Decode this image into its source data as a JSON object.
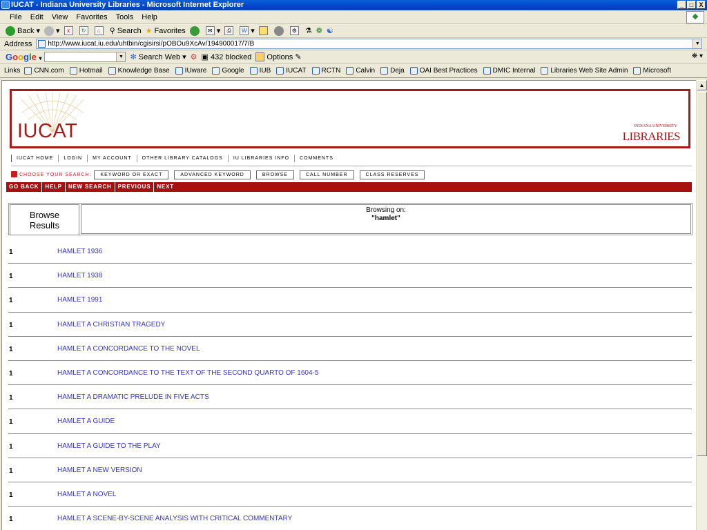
{
  "window": {
    "title": "IUCAT - Indiana University Libraries - Microsoft Internet Explorer",
    "minimize": "_",
    "maximize": "□",
    "close": "X"
  },
  "menu": [
    "File",
    "Edit",
    "View",
    "Favorites",
    "Tools",
    "Help"
  ],
  "toolbar": {
    "back": "Back",
    "search": "Search",
    "favorites": "Favorites"
  },
  "address": {
    "label": "Address",
    "url": "http://www.iucat.iu.edu/uhtbin/cgisirsi/pOBOu9XcAv/194900017/7/B"
  },
  "google": {
    "search_web": "Search Web",
    "blocked": "432 blocked",
    "options": "Options"
  },
  "links": {
    "label": "Links",
    "items": [
      "CNN.com",
      "Hotmail",
      "Knowledge Base",
      "IUware",
      "Google",
      "IUB",
      "IUCAT",
      "RCTN",
      "Calvin",
      "Deja",
      "OAI Best Practices",
      "DMIC Internal",
      "Libraries Web Site Admin",
      "Microsoft"
    ]
  },
  "banner": {
    "logo": "IUCAT",
    "org_small": "INDIANA UNIVERSITY",
    "libraries": "LIBRARIES"
  },
  "nav": [
    "IUCAT HOME",
    "LOGIN",
    "MY ACCOUNT",
    "OTHER LIBRARY CATALOGS",
    "IU LIBRARIES INFO",
    "COMMENTS"
  ],
  "search": {
    "choose_label": "CHOOSE YOUR SEARCH:",
    "buttons": [
      "KEYWORD OR EXACT",
      "ADVANCED KEYWORD",
      "BROWSE",
      "CALL NUMBER",
      "CLASS RESERVES"
    ]
  },
  "actions": [
    "GO BACK",
    "HELP",
    "NEW SEARCH",
    "PREVIOUS",
    "NEXT"
  ],
  "browse": {
    "heading_line1": "Browse",
    "heading_line2": "Results",
    "browsing_on": "Browsing on:",
    "term": "\"hamlet\""
  },
  "results": [
    {
      "count": "1",
      "title": "HAMLET 1936"
    },
    {
      "count": "1",
      "title": "HAMLET 1938"
    },
    {
      "count": "1",
      "title": "HAMLET 1991"
    },
    {
      "count": "1",
      "title": "HAMLET A CHRISTIAN TRAGEDY"
    },
    {
      "count": "1",
      "title": "HAMLET A CONCORDANCE TO THE NOVEL"
    },
    {
      "count": "1",
      "title": "HAMLET A CONCORDANCE TO THE TEXT OF THE SECOND QUARTO OF 1604-5"
    },
    {
      "count": "1",
      "title": "HAMLET A DRAMATIC PRELUDE IN FIVE ACTS"
    },
    {
      "count": "1",
      "title": "HAMLET A GUIDE"
    },
    {
      "count": "1",
      "title": "HAMLET A GUIDE TO THE PLAY"
    },
    {
      "count": "1",
      "title": "HAMLET A NEW VERSION"
    },
    {
      "count": "1",
      "title": "HAMLET A NOVEL"
    },
    {
      "count": "1",
      "title": "HAMLET A SCENE-BY-SCENE ANALYSIS WITH CRITICAL COMMENTARY"
    }
  ],
  "colors": {
    "iu_crimson": "#a81a1a",
    "link_blue": "#3434c8",
    "xp_title": "#0a5fd8"
  }
}
